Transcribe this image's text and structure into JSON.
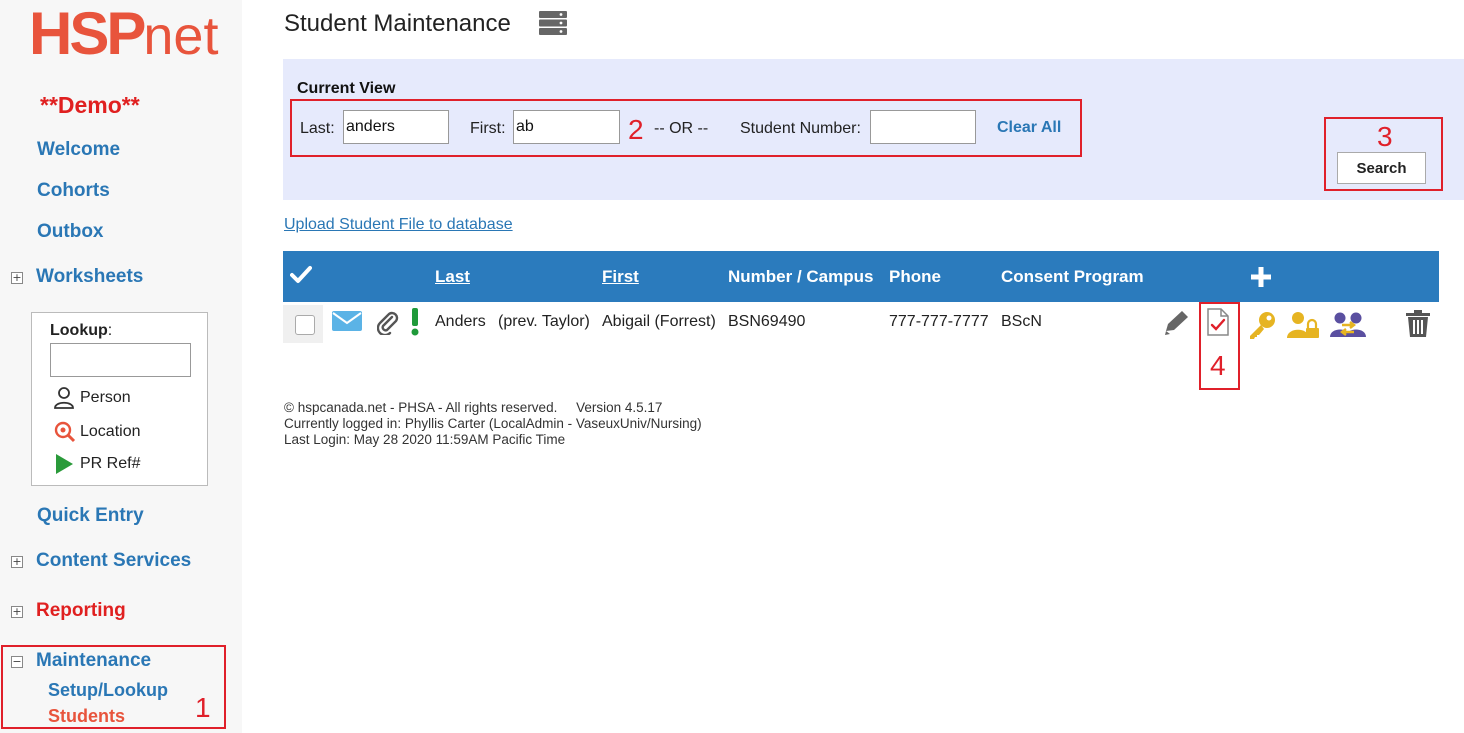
{
  "app": {
    "logo_main": "HSP",
    "logo_suffix": "net",
    "demo_label": "**Demo**"
  },
  "sidebar": {
    "links": {
      "welcome": "Welcome",
      "cohorts": "Cohorts",
      "outbox": "Outbox",
      "worksheets": "Worksheets",
      "quick_entry": "Quick Entry",
      "content_services": "Content Services",
      "reporting": "Reporting",
      "maintenance": "Maintenance",
      "setup_lookup": "Setup/Lookup",
      "students": "Students"
    },
    "expanders": {
      "collapsed": "+",
      "expanded": "−"
    },
    "lookup": {
      "title": "Lookup",
      "colon": ":",
      "input_value": "",
      "options": [
        "Person",
        "Location",
        "PR Ref#"
      ]
    }
  },
  "page": {
    "title": "Student Maintenance"
  },
  "filter": {
    "heading": "Current View",
    "last_label": "Last:",
    "last_value": "anders",
    "first_label": "First:",
    "first_value": "ab",
    "or_label": "-- OR --",
    "student_number_label": "Student Number:",
    "student_number_value": "",
    "clear_all": "Clear All",
    "search_button": "Search"
  },
  "upload_link": "Upload Student File to database",
  "table": {
    "headers": {
      "last": "Last",
      "first": "First",
      "number_campus": "Number / Campus",
      "phone": "Phone",
      "consent_program": "Consent Program",
      "add": "+"
    },
    "rows": [
      {
        "last": "Anders",
        "prev": "(prev. Taylor)",
        "first": "Abigail (Forrest)",
        "number": "BSN69490",
        "phone": "777-777-7777",
        "program": "BScN"
      }
    ]
  },
  "annotations": {
    "n1": "1",
    "n2": "2",
    "n3": "3",
    "n4": "4"
  },
  "footer": {
    "line1": "© hspcanada.net - PHSA - All rights reserved.     Version 4.5.17",
    "line2": "Currently logged in: Phyllis Carter (LocalAdmin - VaseuxUniv/Nursing)",
    "line3": "Last Login: May 28 2020 11:59AM Pacific Time"
  },
  "colors": {
    "brand": "#e8543c",
    "link": "#2a77b5",
    "header_bar": "#2b7bbd",
    "filter_bg": "#e6eafc",
    "annotation_red": "#e0202a",
    "key_gold": "#e6b422",
    "people_purple": "#5a4fa0"
  },
  "icons": [
    "server-icon",
    "person-icon",
    "location-search-icon",
    "play-icon",
    "check-icon",
    "plus-icon",
    "email-icon",
    "paperclip-icon",
    "alert-icon",
    "pencil-icon",
    "document-check-icon",
    "key-icon",
    "user-lock-icon",
    "user-swap-icon",
    "trash-icon"
  ]
}
